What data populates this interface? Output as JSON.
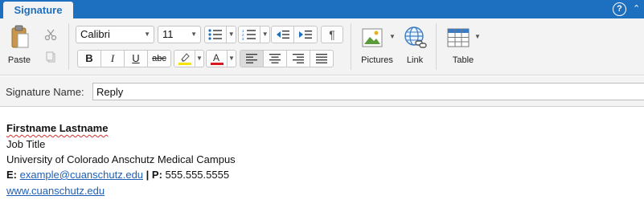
{
  "tabs": {
    "active": "Signature"
  },
  "window_controls": {
    "help": "?",
    "collapse": "⌃"
  },
  "clipboard": {
    "paste_label": "Paste"
  },
  "font": {
    "family": "Calibri",
    "size": "11"
  },
  "format_buttons": {
    "bold": "B",
    "italic": "I",
    "underline": "U",
    "strikethrough": "abc"
  },
  "paragraph_mark": "¶",
  "insert": {
    "pictures_label": "Pictures",
    "link_label": "Link",
    "table_label": "Table"
  },
  "signature_name": {
    "label": "Signature Name:",
    "value": "Reply"
  },
  "signature": {
    "name": "Firstname Lastname",
    "title": "Job Title",
    "organization": "University of Colorado Anschutz Medical Campus",
    "email_label": "E:",
    "email": "example@cuanschutz.edu",
    "separator": "|",
    "phone_label": "P:",
    "phone": "555.555.5555",
    "website": "www.cuanschutz.edu"
  },
  "colors": {
    "accent": "#1d6fc0",
    "highlight": "#f5e300",
    "font_color": "#d9181f",
    "link": "#1f5fb8"
  }
}
